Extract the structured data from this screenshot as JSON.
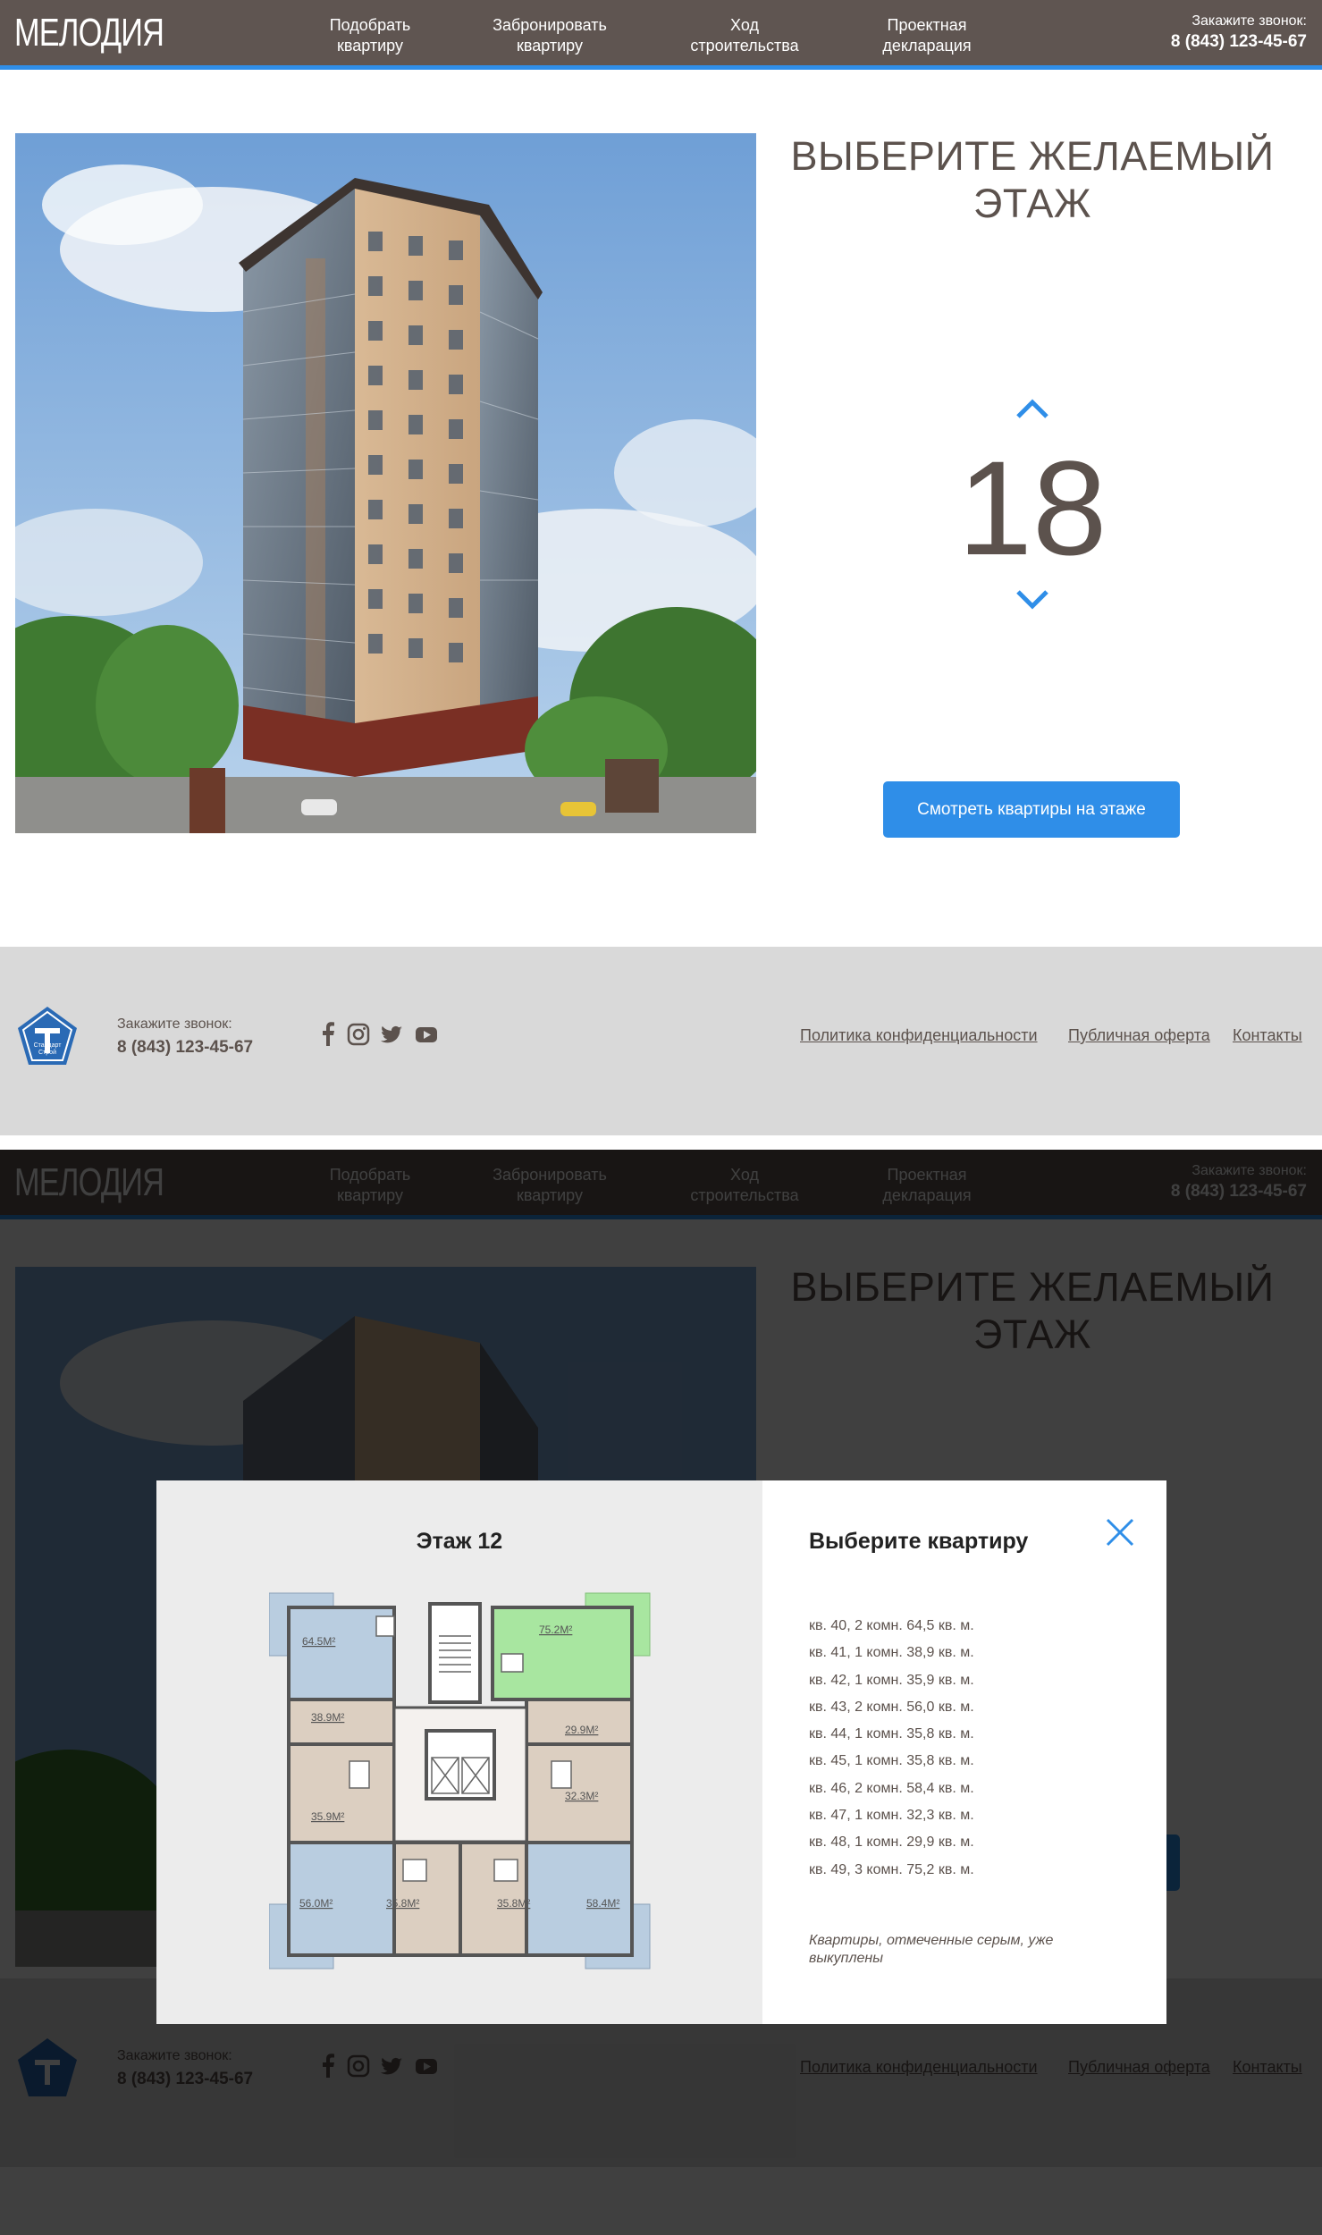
{
  "header": {
    "logo": "МЕЛОДИЯ",
    "nav": [
      {
        "line1": "Подобрать",
        "line2": "квартиру"
      },
      {
        "line1": "Забронировать",
        "line2": "квартиру"
      },
      {
        "line1": "Ход",
        "line2": "строительства"
      },
      {
        "line1": "Проектная",
        "line2": "декларация"
      }
    ],
    "phone_label": "Закажите звонок:",
    "phone_number": "8 (843) 123-45-67"
  },
  "hero": {
    "title_line1": "ВЫБЕРИТЕ ЖЕЛАЕМЫЙ",
    "title_line2": "ЭТАЖ",
    "floor": "18",
    "button_label": "Смотреть квартиры на этаже"
  },
  "footer": {
    "logo_line1": "Стандарт",
    "logo_line2": "Строй",
    "phone_label": "Закажите звонок:",
    "phone_number": "8 (843) 123-45-67",
    "socials": [
      "facebook-icon",
      "instagram-icon",
      "twitter-icon",
      "youtube-icon"
    ],
    "links": [
      "Политика конфиденциальности",
      "Публичная оферта",
      "Контакты"
    ]
  },
  "modal": {
    "floor_title": "Этаж 12",
    "select_title": "Выберите квартиру",
    "apartments": [
      "кв. 40, 2 комн. 64,5 кв. м.",
      "кв. 41, 1 комн. 38,9 кв. м.",
      "кв. 42, 1 комн. 35,9 кв. м.",
      "кв. 43, 2 комн. 56,0 кв. м.",
      "кв. 44, 1 комн. 35,8 кв. м.",
      "кв. 45, 1 комн. 35,8 кв. м.",
      "кв. 46, 2 комн. 58,4 кв. м.",
      "кв. 47, 1 комн. 32,3 кв. м.",
      "кв. 48, 1 комн. 29,9 кв. м.",
      "кв. 49, 3 комн. 75,2 кв. м."
    ],
    "note": "Квартиры, отмеченные серым, уже выкуплены",
    "plan_labels": [
      "64.5М²",
      "38.9М²",
      "35.9М²",
      "56.0М²",
      "35.8М²",
      "35.8М²",
      "58.4М²",
      "32.3М²",
      "29.9М²",
      "75.2М²"
    ]
  },
  "colors": {
    "header_bg": "#5f5551",
    "accent": "#2f8ee8",
    "text": "#5c524d",
    "footer_bg": "#d9d9d9",
    "apt_blue": "#b9cde0",
    "apt_beige": "#dccfc1",
    "apt_green": "#a8e6a0"
  }
}
